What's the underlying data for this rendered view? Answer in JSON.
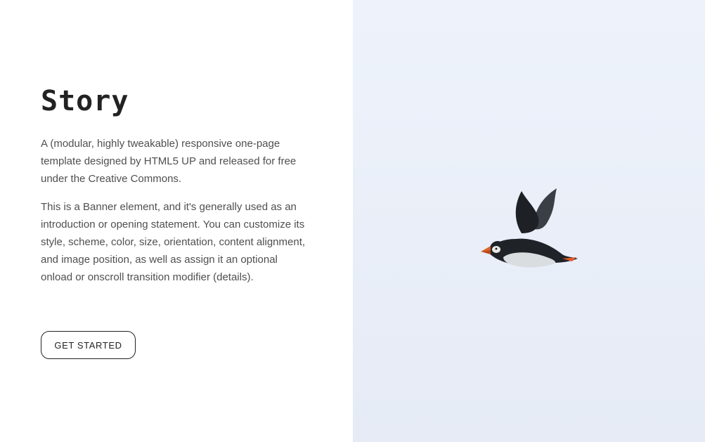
{
  "banner": {
    "title": "Story",
    "paragraphs": [
      "A (modular, highly tweakable) responsive one-page template designed by HTML5 UP and released for free under the Creative Commons.",
      "This is a Banner element, and it's generally used as an introduction or opening statement. You can customize its style, scheme, color, size, orientation, content alignment, and image position, as well as assign it an optional onload or onscroll transition modifier (details)."
    ],
    "button_label": "GET STARTED",
    "image": {
      "subject": "puffin-in-flight",
      "sky_color": "#eaf0f9"
    }
  },
  "colors": {
    "text": "#222222",
    "body_text": "#4f4f4f",
    "background": "#ffffff"
  }
}
